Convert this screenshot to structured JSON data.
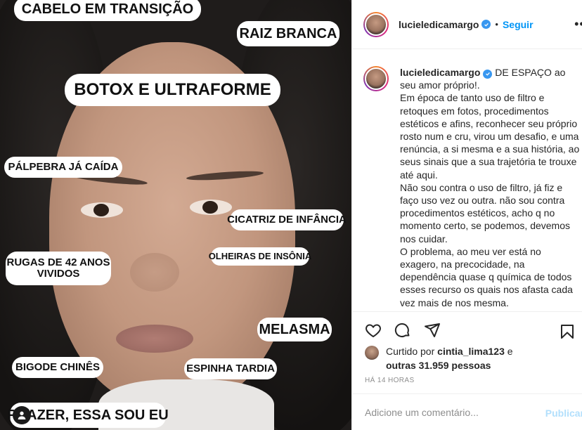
{
  "photo": {
    "tags": {
      "hair_transition": "CABELO EM TRANSIÇÃO",
      "white_root": "RAIZ BRANCA",
      "botox": "BOTOX E ULTRAFORME",
      "eyelid": "PÁLPEBRA JÁ CAÍDA",
      "scar": "CICATRIZ DE INFÂNCIA",
      "wrinkles": "RUGAS DE 42 ANOS\nVIVIDOS",
      "dark_circles": "OLHEIRAS DE INSÔNIA",
      "melasma": "MELASMA",
      "mustache": "BIGODE CHINÊS",
      "late_pimple": "ESPINHA TARDIA",
      "pleasure": "PRAZER, ESSA SOU EU"
    }
  },
  "header": {
    "username": "lucieledicamargo",
    "separator": "•",
    "follow_label": "Seguir",
    "more_icon": "more-horizontal-icon"
  },
  "caption": {
    "username": "lucieledicamargo",
    "text": " DE ESPAÇO ao seu amor próprio!.\nEm época de tanto uso de filtro e retoques em fotos, procedimentos estéticos e afins, reconhecer seu próprio rosto num e cru, virou um desafio, e uma renúncia, a si mesma e a sua história, ao seus sinais que a sua trajetória te trouxe até aqui.\nNão sou contra o uso de filtro, já fiz e faço uso vez ou outra. não sou contra procedimentos estéticos, acho q no momento certo, se podemos, devemos nos cuidar.\nO problema, ao meu ver está no exagero, na precocidade, na dependência quase q química de todos esses recurso os quais nos afasta cada vez mais de nos mesma."
  },
  "actions": {
    "icons": [
      "heart-icon",
      "comment-icon",
      "share-icon",
      "bookmark-icon"
    ]
  },
  "likes": {
    "prefix": "Curtido por ",
    "liker": "cintia_lima123",
    "mid": " e",
    "others": "outras 31.959 pessoas"
  },
  "timestamp": "HÁ 14 HORAS",
  "comment": {
    "placeholder": "Adicione um comentário...",
    "publish_label": "Publicar"
  },
  "colors": {
    "accent": "#0095f6",
    "verified": "#3897f0",
    "publish_disabled": "#b2dffc",
    "muted": "#8e8e8e"
  }
}
